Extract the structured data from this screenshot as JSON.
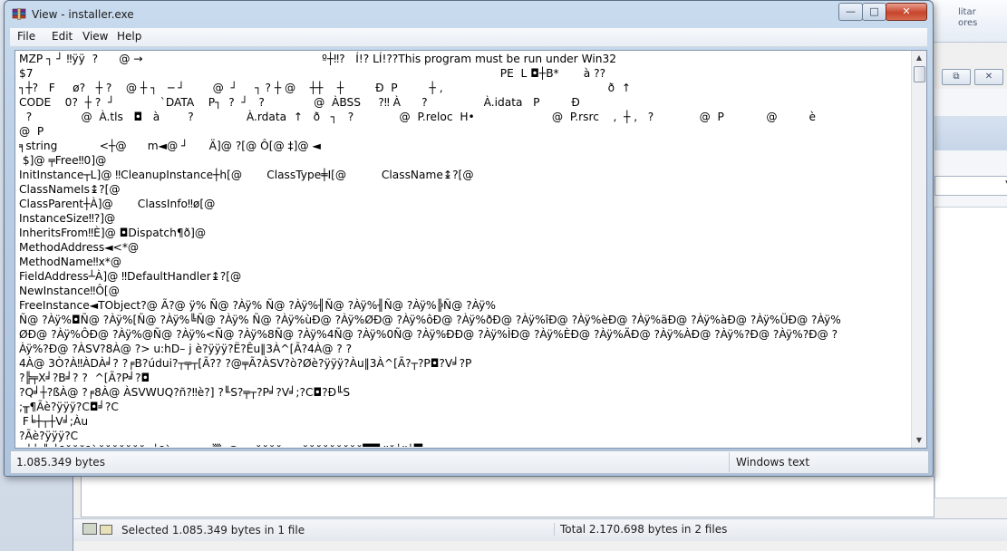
{
  "viewer": {
    "title": "View - installer.exe",
    "menu": [
      "File",
      "Edit",
      "View",
      "Help"
    ],
    "text_lines": [
      "MZP ┐ ┘ ‼ÿÿ  ?      @ →                                                   º┼‼?   Í!? LÍ!??This program must be run under Win32",
      "$7                                                                                                                                     PE  L ◘┼B*       à ??",
      "┐┼?   F     ø?   ┼ ?    @ ┼ ┐   ─ ┘        @  ┘     ┐ ? ┼ @    ┼┼    ┼         Ð  P         ┼ ,                                               ð  ↑",
      "CODE    0?  ┼ ?  ┘             `DATA    P┐  ?  ┘   ?              @  ÀBSS     ?‼ À      ?                À.idata   P         Ð",
      "  ?              @  À.tls   ◘   à        ?               À.rdata  ↑   ð   ┐   ?             @  P.reloc  H•                      @  P.rsrc    ,  ┼ ,   ?             @  P            @         è",
      "@  P",
      "╕string            <┼@      m◄@ ┘      Ä]@ ?[@ Ô[@ ‡]@ ◄",
      " $]@ ╤Free‼0]@",
      "InitInstance┬L]@ ‼CleanupInstance┼h[@       ClassType╪I[@          ClassName↨?[@",
      "ClassNameIs↨?[@",
      "ClassParent┼À]@       ClassInfo‼ø[@",
      "InstanceSize‼?]@",
      "InheritsFrom‼È]@ ◘Dispatch¶ð]@",
      "MethodAddress◄<*@",
      "MethodName‼x*@",
      "FieldAddress┴À]@ ‼DefaultHandler↨?[@",
      "NewInstance‼Ô[@",
      "FreeInstance◄TObject?@ Ã?@ ÿ% Ñ@ ?Àÿ% Ñ@ ?Àÿ%╢Ñ@ ?Àÿ%╢Ñ@ ?Àÿ%╠Ñ@ ?Àÿ%",
      "Ñ@ ?Àÿ%◘Ñ@ ?Àÿ%[Ñ@ ?Àÿ%╚Ñ@ ?Àÿ% Ñ@ ?Àÿ%ùÐ@ ?Àÿ%ØÐ@ ?Àÿ%ôÐ@ ?Àÿ%ðÐ@ ?Àÿ%îÐ@ ?Àÿ%èÐ@ ?Àÿ%äÐ@ ?Àÿ%àÐ@ ?Àÿ%ÜÐ@ ?Àÿ%",
      "ØÐ@ ?Àÿ%ÔÐ@ ?Àÿ%@Ñ@ ?Àÿ%<Ñ@ ?Àÿ%8Ñ@ ?Àÿ%4Ñ@ ?Àÿ%0Ñ@ ?Àÿ%ÐÐ@ ?Àÿ%ÌÐ@ ?Àÿ%ÈÐ@ ?Àÿ%ÄÐ@ ?Àÿ%ÀÐ@ ?Àÿ%?Ð@ ?Àÿ%?Ð@ ?",
      "Àÿ%?Ð@ ?ÀSV?8À@ ?> u:hD– j è?ÿÿÿ?Ë?Êu‖3À^[Ã?4À@ ? ?",
      "4À@ 3Ò?À‼ÀDÀ╛? ?╒B?údui?┬╤┬[Ã?? ?@╤Ã?ÀSV?ò?Øè?ÿÿÿ?Àu‖3À^[Ã?┬?P◘?V╛?P",
      "?╠╤X╛?B╛? ?  ^[Ã?P╛?◘",
      "?Q╛┼?ßÀ@ ?╒8À@ ÀSVWUQ?ñ?‼è?] ?╙S?╤┬?P╛?V╛;?C◘?Ð╙S",
      ";╥¶Ãè?ÿÿÿ?C◘╛?C",
      " F╘┼┬┼V╛;Àu",
      "?Ãè?ÿÿÿ?C",
      "═╘╘ ╬ ╘?ŏŏŏ?àŏŏŏŏŏŏŏ  ╘?à  ┬ ┬   ╦▒╔@  ∞ŏŏŏŏ   ∞ŏŏŏŏŏŏŏŏŏ▀▀ ‼ŏ┘‼┘▀"
    ],
    "status_size": "1.085.349 bytes",
    "status_encoding": "Windows text",
    "scroll_up_glyph": "▲",
    "scroll_down_glyph": "▼",
    "close_glyph": "✕",
    "max_glyph": "□",
    "min_glyph": "—"
  },
  "background_window": {
    "ribbon_fragment_1": "litar",
    "ribbon_fragment_2": "ores",
    "status_selected": "Selected 1.085.349 bytes in 1 file",
    "status_total": "Total 2.170.698 bytes in 2 files",
    "inner_restore_glyph": "⧉",
    "inner_close_glyph": "✕",
    "dropdown_arrow": "▼"
  }
}
